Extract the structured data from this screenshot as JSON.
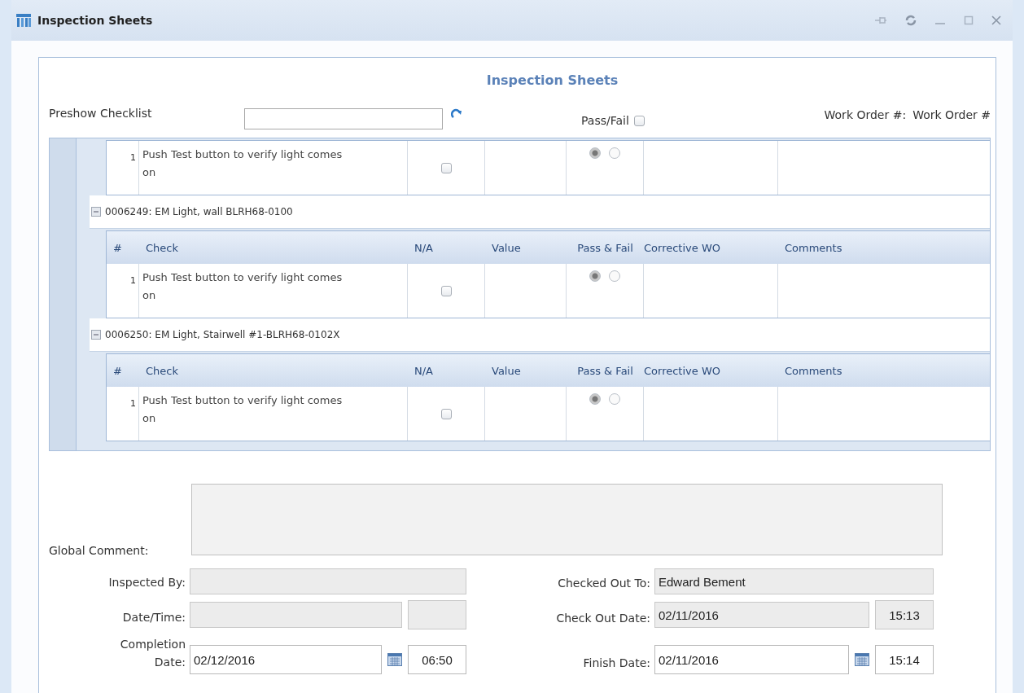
{
  "window": {
    "title": "Inspection Sheets"
  },
  "panel_title": "Inspection Sheets",
  "header": {
    "checklist_label": "Preshow Checklist",
    "pass_fail_label": "Pass/Fail",
    "pass_fail_checked": false,
    "work_order_label": "Work Order #:",
    "work_order_value": "Work Order #"
  },
  "groups": [
    {
      "rows": [
        {
          "number": "1",
          "check": "Push Test button to verify light comes on",
          "na_checked": false,
          "pass_fail": [
            {
              "selected": true
            },
            {
              "selected": false
            }
          ]
        }
      ]
    },
    {
      "title": "0006249: EM Light, wall BLRH68-0100",
      "expanded": true,
      "columns": [
        "#",
        "Check",
        "N/A",
        "Value",
        "Pass & Fail",
        "Corrective WO",
        "Comments"
      ],
      "rows": [
        {
          "number": "1",
          "check": "Push Test button to verify light comes on",
          "na_checked": false,
          "pass_fail": [
            {
              "selected": true
            },
            {
              "selected": false
            }
          ]
        }
      ]
    },
    {
      "title": "0006250: EM Light, Stairwell #1-BLRH68-0102X",
      "expanded": true,
      "columns": [
        "#",
        "Check",
        "N/A",
        "Value",
        "Pass & Fail",
        "Corrective WO",
        "Comments"
      ],
      "rows": [
        {
          "number": "1",
          "check": "Push Test button to verify light comes on",
          "na_checked": false,
          "pass_fail": [
            {
              "selected": true
            },
            {
              "selected": false
            }
          ]
        }
      ]
    }
  ],
  "global_comment": {
    "label": "Global Comment:",
    "disabled": true
  },
  "form_rows": [
    {
      "items": [
        {
          "label": "Inspected By:",
          "inputs": [
            {
              "kind": "text",
              "disabled": true
            }
          ]
        },
        {
          "label": "Checked Out To:",
          "inputs": [
            {
              "kind": "text",
              "disabled": true,
              "value": "Edward Bement"
            }
          ]
        }
      ]
    },
    {
      "items": [
        {
          "label": "Date/Time:",
          "inputs": [
            {
              "kind": "date",
              "disabled": true
            },
            {
              "kind": "time",
              "disabled": true
            }
          ]
        },
        {
          "label": "Check Out Date:",
          "inputs": [
            {
              "kind": "date",
              "disabled": true,
              "value": "02/11/2016"
            },
            {
              "kind": "time",
              "disabled": true,
              "value": "15:13"
            }
          ]
        }
      ]
    },
    {
      "items": [
        {
          "label": "Completion Date:",
          "inputs": [
            {
              "kind": "date_picker",
              "disabled": false,
              "value": "02/12/2016"
            },
            {
              "kind": "time",
              "disabled": false,
              "value": "06:50"
            }
          ]
        },
        {
          "label": "Finish Date:",
          "inputs": [
            {
              "kind": "date_picker",
              "disabled": false,
              "value": "02/11/2016"
            },
            {
              "kind": "time",
              "disabled": false,
              "value": "15:14"
            }
          ]
        }
      ]
    }
  ]
}
